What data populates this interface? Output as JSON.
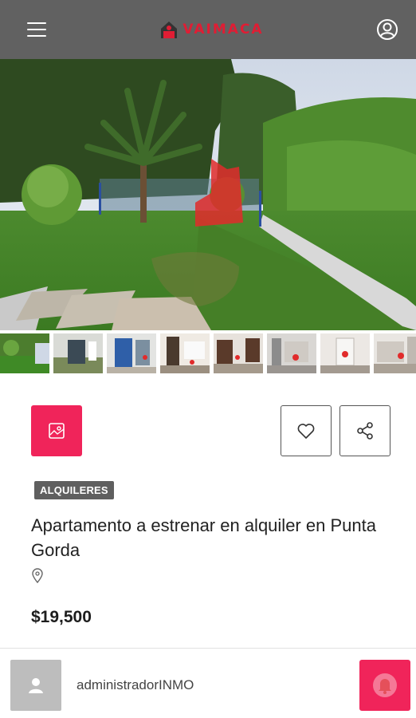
{
  "header": {
    "brand": "VAIMACA",
    "brand_color": "#e01d34",
    "icons": {
      "menu": "hamburger-menu-icon",
      "account": "user-circle-icon"
    }
  },
  "gallery": {
    "photo_count_visible": 8,
    "icons": {
      "open_gallery": "image-gallery-icon"
    }
  },
  "actions": {
    "icons": {
      "favorite": "heart-icon",
      "share": "share-icon"
    },
    "accent_color": "#f0245a"
  },
  "listing": {
    "category": "ALQUILERES",
    "title": "Apartamento a estrenar en alquiler en Punta Gorda",
    "location_icon": "map-pin-icon",
    "price": "$19,500"
  },
  "footer": {
    "agent_name": "administradorINMO",
    "icons": {
      "avatar": "person-icon",
      "contact": "bell-icon"
    }
  }
}
